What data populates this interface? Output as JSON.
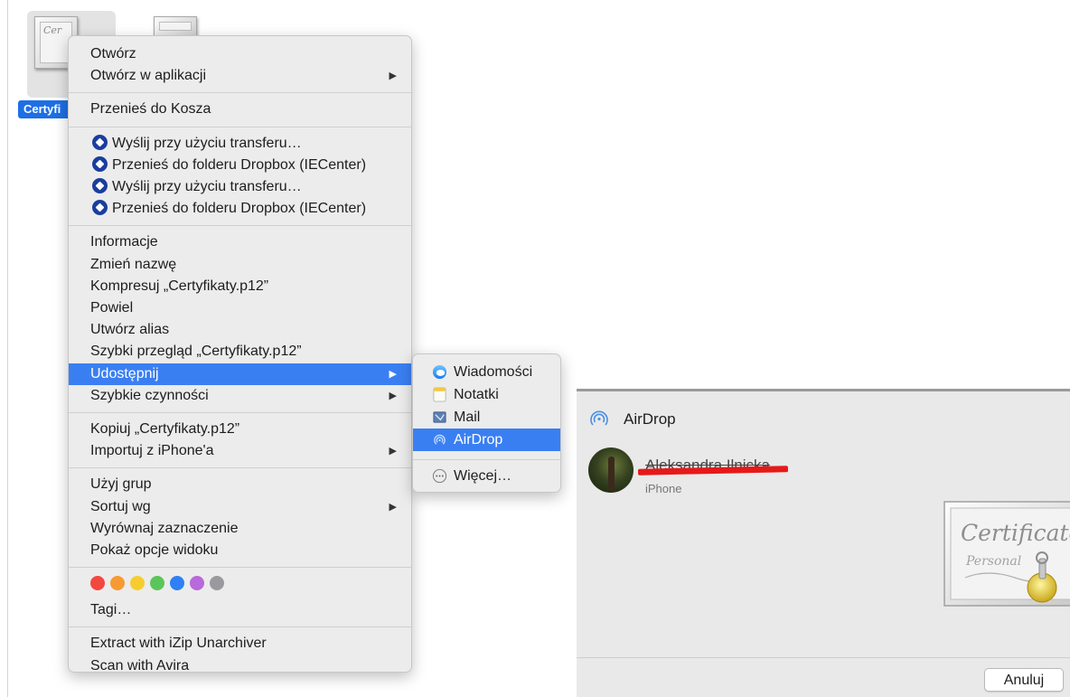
{
  "file": {
    "label": "Certyfi"
  },
  "context_menu": {
    "groups": [
      [
        {
          "label": "Otwórz"
        },
        {
          "label": "Otwórz w aplikacji",
          "submenu": true
        }
      ],
      [
        {
          "label": "Przenieś do Kosza"
        }
      ],
      [
        {
          "label": "Wyślij przy użyciu transferu…",
          "icon": "dropbox-icon"
        },
        {
          "label": "Przenieś do folderu Dropbox (IECenter)",
          "icon": "dropbox-icon"
        },
        {
          "label": "Wyślij przy użyciu transferu…",
          "icon": "dropbox-icon"
        },
        {
          "label": "Przenieś do folderu Dropbox (IECenter)",
          "icon": "dropbox-icon"
        }
      ],
      [
        {
          "label": "Informacje"
        },
        {
          "label": "Zmień nazwę"
        },
        {
          "label": "Kompresuj „Certyfikaty.p12”"
        },
        {
          "label": "Powiel"
        },
        {
          "label": "Utwórz alias"
        },
        {
          "label": "Szybki przegląd „Certyfikaty.p12”"
        },
        {
          "label": "Udostępnij",
          "submenu": true,
          "highlighted": true
        },
        {
          "label": "Szybkie czynności",
          "submenu": true
        }
      ],
      [
        {
          "label": "Kopiuj „Certyfikaty.p12”"
        },
        {
          "label": "Importuj z iPhone'a",
          "submenu": true
        }
      ],
      [
        {
          "label": "Użyj grup"
        },
        {
          "label": "Sortuj wg",
          "submenu": true
        },
        {
          "label": "Wyrównaj zaznaczenie"
        },
        {
          "label": "Pokaż opcje widoku"
        }
      ],
      [
        {
          "label": "Tagi…"
        }
      ],
      [
        {
          "label": "Extract with iZip Unarchiver"
        },
        {
          "label": "Scan with Avira"
        }
      ]
    ],
    "tag_colors": [
      "#f2483f",
      "#f79a34",
      "#f6cd30",
      "#5ac659",
      "#2e80f4",
      "#b969d9",
      "#9a9a9e"
    ],
    "highlight_color": "#3a7ff2"
  },
  "share_submenu": {
    "items": [
      {
        "label": "Wiadomości",
        "icon": "messages-icon"
      },
      {
        "label": "Notatki",
        "icon": "notes-icon"
      },
      {
        "label": "Mail",
        "icon": "mail-icon"
      },
      {
        "label": "AirDrop",
        "icon": "airdrop-icon",
        "highlighted": true
      }
    ],
    "more_label": "Więcej…"
  },
  "airdrop": {
    "title": "AirDrop",
    "device_name": "Aleksandra Ilnicka",
    "device_type": "iPhone",
    "cert_script_1": "Certificate",
    "cert_script_2": "Personal",
    "cancel_label": "Anuluj"
  }
}
